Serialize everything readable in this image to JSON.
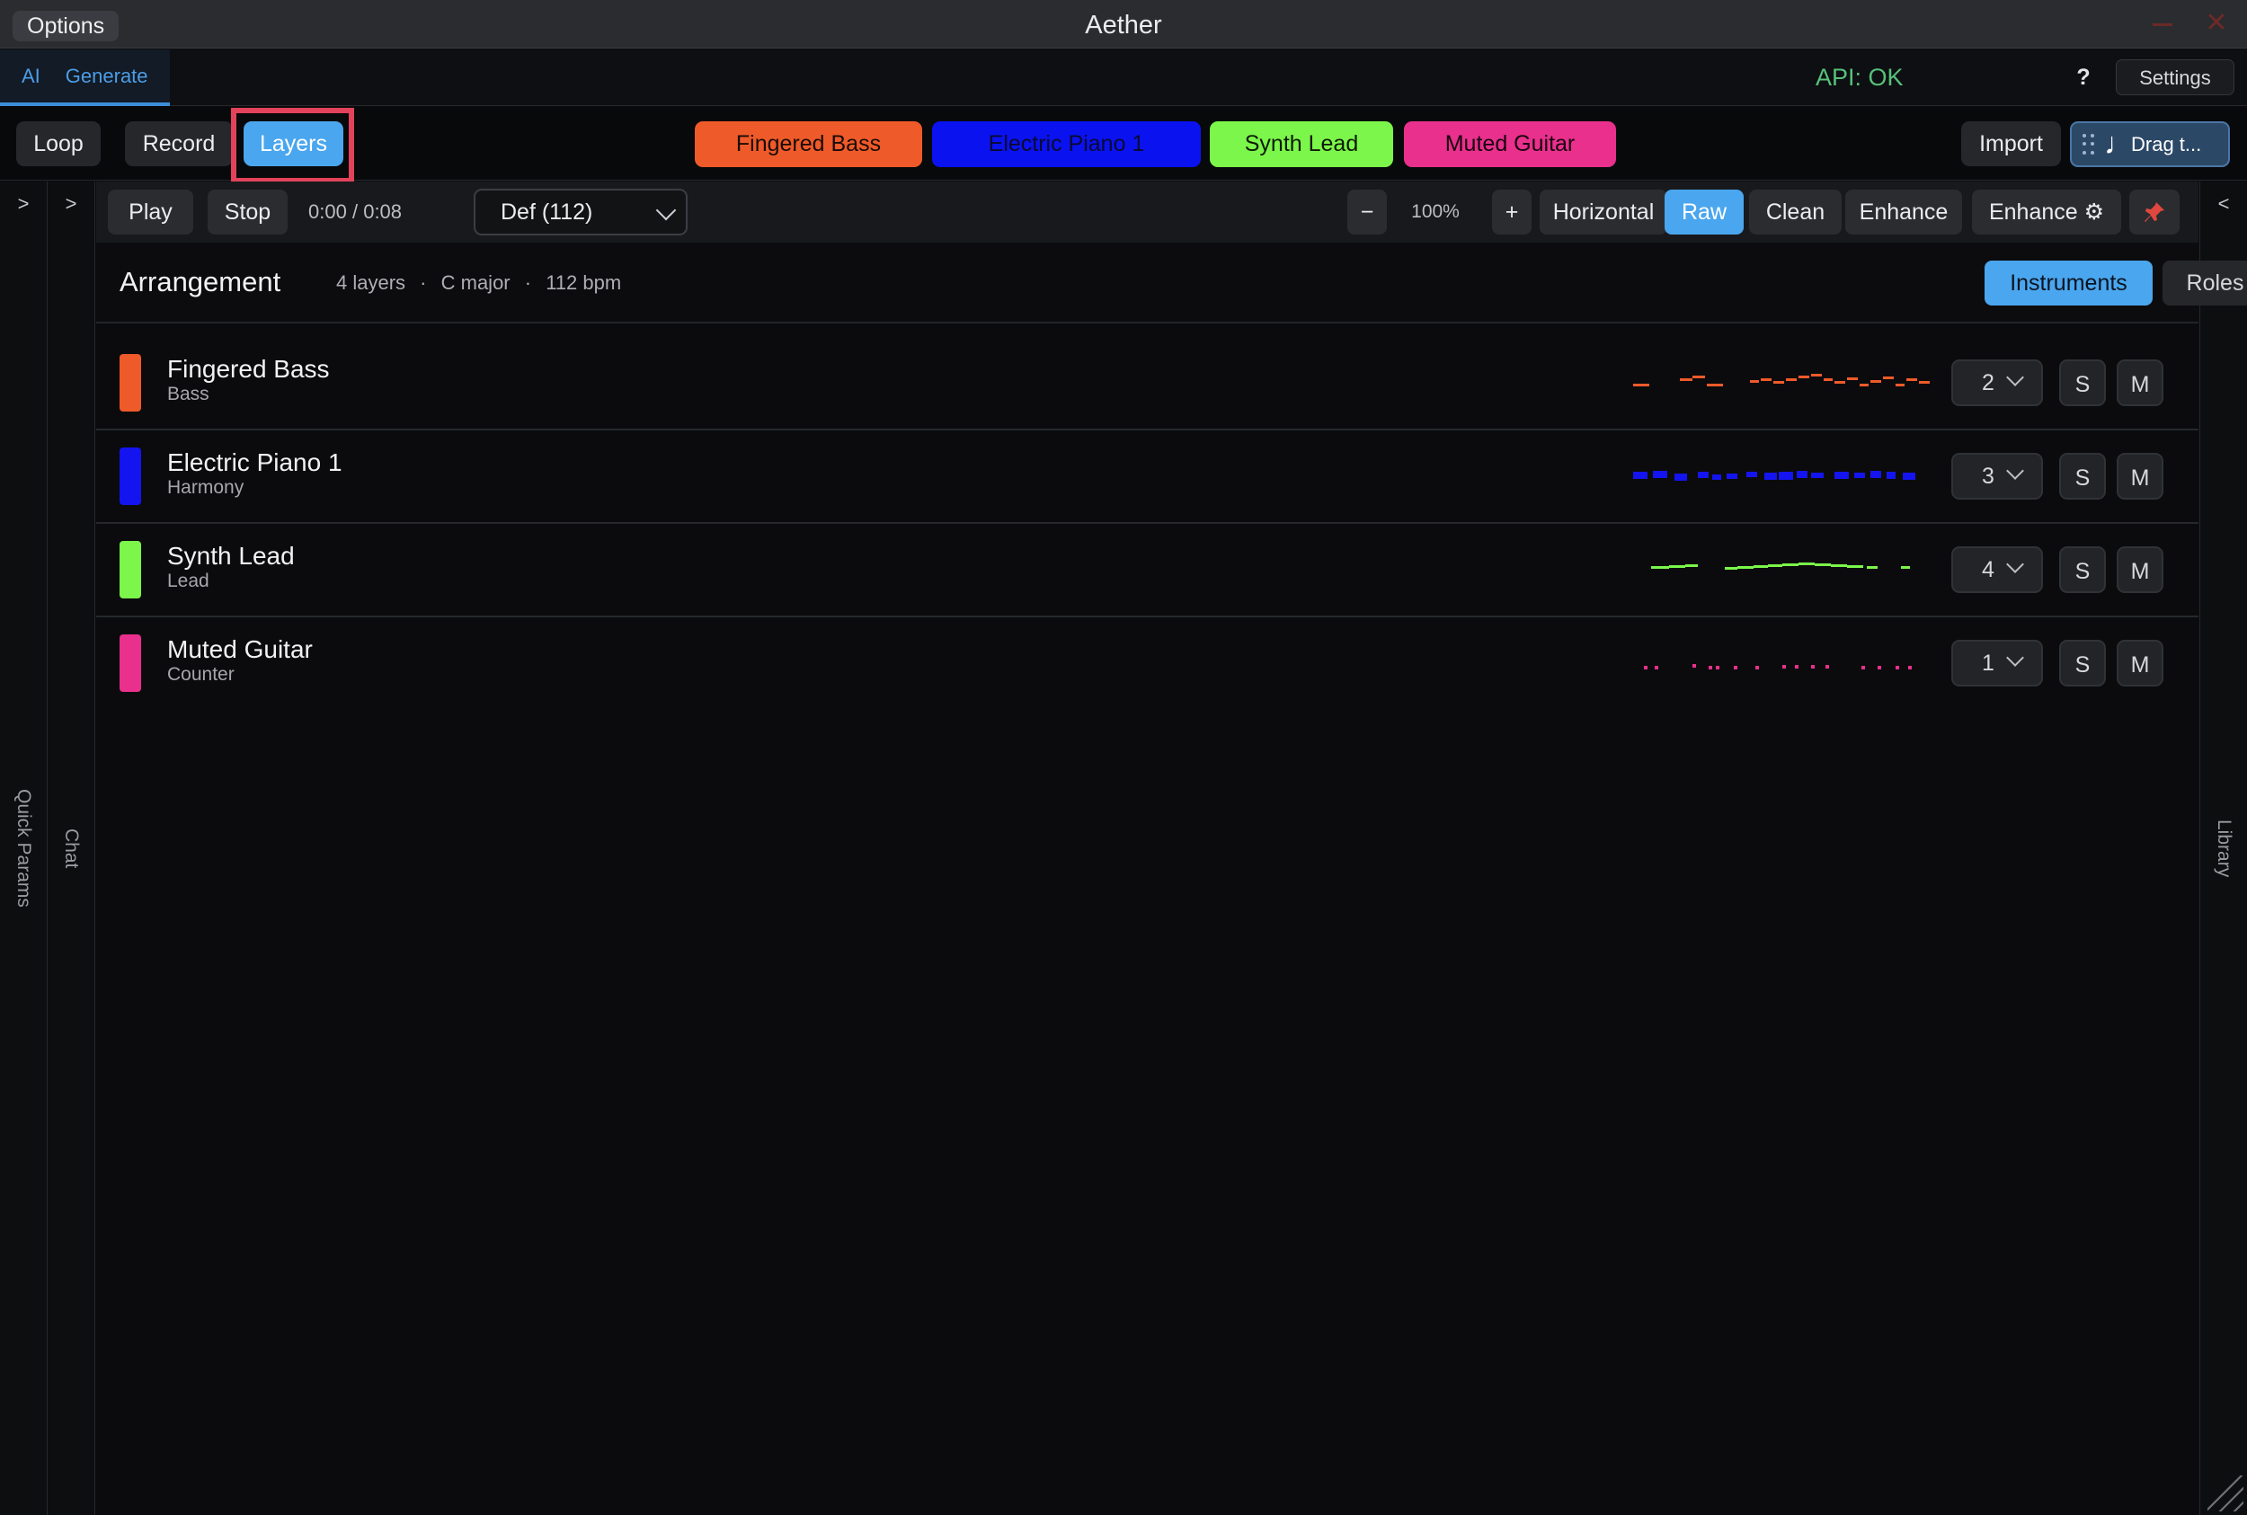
{
  "titlebar": {
    "options_label": "Options",
    "app_title": "Aether"
  },
  "modebar": {
    "tab_prefix": "AI",
    "tab_label": "Generate",
    "api_status": "API: OK",
    "help_label": "?",
    "settings_label": "Settings"
  },
  "toolbar": {
    "loop_label": "Loop",
    "record_label": "Record",
    "layers_label": "Layers",
    "import_label": "Import",
    "drag_label": "Drag t...",
    "instruments": [
      {
        "label": "Fingered Bass",
        "color": "#ef5a2a",
        "text_color": "#1a0c06"
      },
      {
        "label": "Electric Piano 1",
        "color": "#0a12f0",
        "text_color": "#0a0a30"
      },
      {
        "label": "Synth Lead",
        "color": "#7cf64a",
        "text_color": "#0c1a06"
      },
      {
        "label": "Muted Guitar",
        "color": "#e8308c",
        "text_color": "#1a0410"
      }
    ]
  },
  "transport": {
    "play_label": "Play",
    "stop_label": "Stop",
    "time_current": "0:00",
    "time_sep": "/",
    "time_total": "0:08",
    "preset_value": "Def (112)",
    "zoom_out_label": "−",
    "zoom_value": "100%",
    "zoom_in_label": "+",
    "orientation_label": "Horizontal",
    "raw_label": "Raw",
    "clean_label": "Clean",
    "enhance_label": "Enhance",
    "enhance_settings_label": "Enhance ⚙"
  },
  "rails": {
    "quick_params_label": "Quick Params",
    "chat_label": "Chat",
    "library_label": "Library",
    "left_chevron": ">",
    "right_chevron": "<"
  },
  "arrangement": {
    "title": "Arrangement",
    "layers_count": "4 layers",
    "key": "C major",
    "tempo": "112 bpm",
    "separator": "·",
    "view_instruments_label": "Instruments",
    "view_roles_label": "Roles"
  },
  "layers": [
    {
      "name": "Fingered Bass",
      "role": "Bass",
      "color": "#ef5a2a",
      "channel": "2",
      "solo": "S",
      "mute": "M"
    },
    {
      "name": "Electric Piano 1",
      "role": "Harmony",
      "color": "#1414f0",
      "channel": "3",
      "solo": "S",
      "mute": "M"
    },
    {
      "name": "Synth Lead",
      "role": "Lead",
      "color": "#7cf64a",
      "channel": "4",
      "solo": "S",
      "mute": "M"
    },
    {
      "name": "Muted Guitar",
      "role": "Counter",
      "color": "#e8308c",
      "channel": "1",
      "solo": "S",
      "mute": "M"
    }
  ]
}
